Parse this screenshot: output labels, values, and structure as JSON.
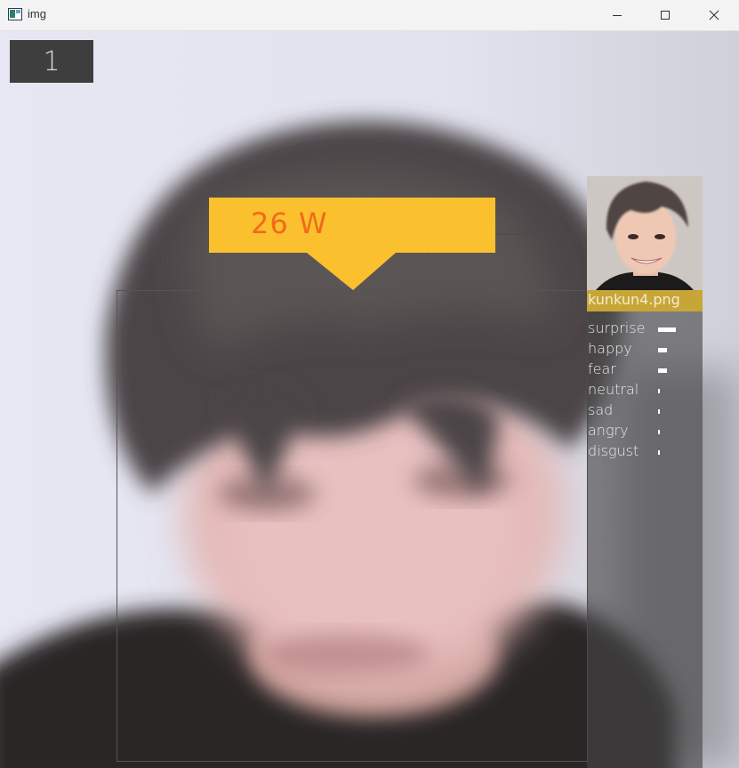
{
  "window": {
    "title": "img",
    "icons": {
      "app": "app-window-icon",
      "minimize": "minimize-icon",
      "maximize": "maximize-icon",
      "close": "close-icon"
    }
  },
  "overlay": {
    "frame_counter": "1",
    "age_gender_label": "26 W",
    "callout_color": "#fbc02d",
    "label_color": "#f26a1b",
    "match_name": "kunkun4.png",
    "name_bar_color": "#c7a637",
    "emotions": [
      {
        "label": "surprise",
        "score": 0.9
      },
      {
        "label": "happy",
        "score": 0.45
      },
      {
        "label": "fear",
        "score": 0.45
      },
      {
        "label": "neutral",
        "score": 0.1
      },
      {
        "label": "sad",
        "score": 0.05
      },
      {
        "label": "angry",
        "score": 0.05
      },
      {
        "label": "disgust",
        "score": 0.05
      }
    ]
  }
}
